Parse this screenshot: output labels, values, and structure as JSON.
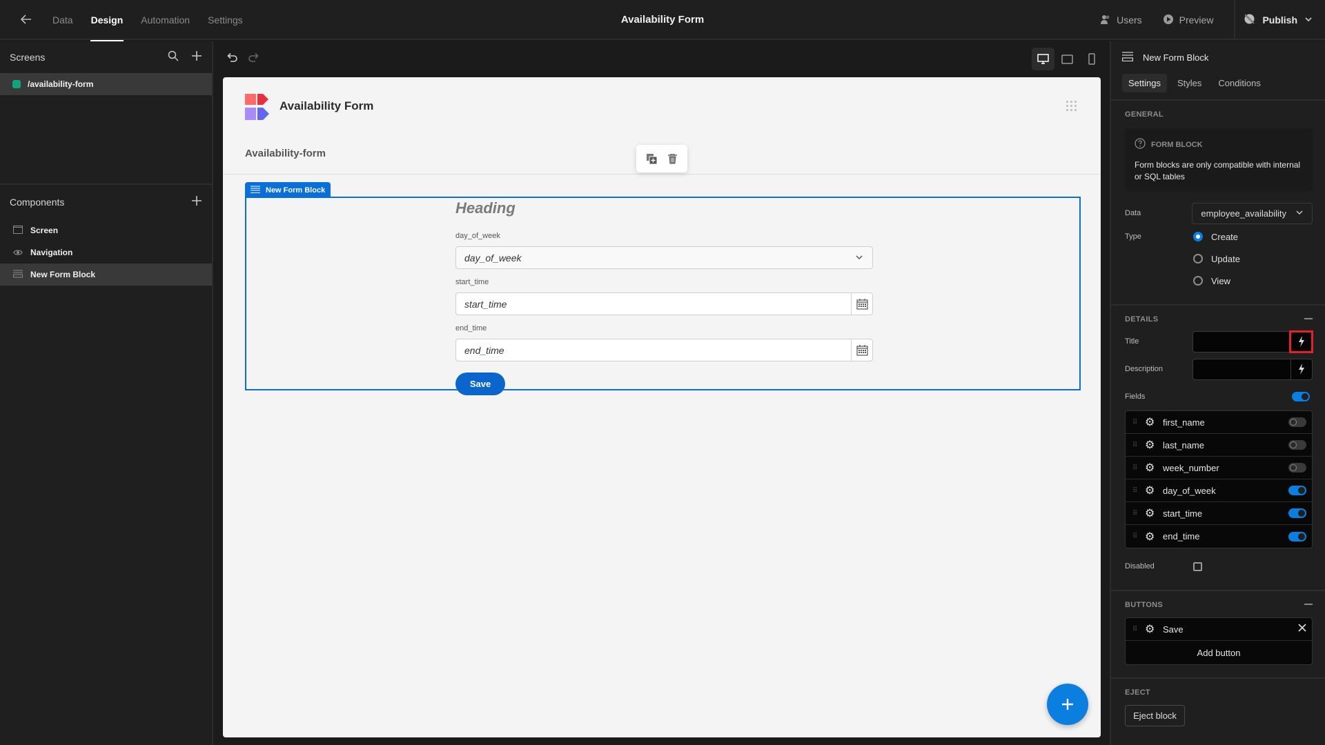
{
  "topbar": {
    "nav_tabs": [
      {
        "label": "Data",
        "active": false
      },
      {
        "label": "Design",
        "active": true
      },
      {
        "label": "Automation",
        "active": false
      },
      {
        "label": "Settings",
        "active": false
      }
    ],
    "app_title": "Availability Form",
    "users_label": "Users",
    "preview_label": "Preview",
    "publish_label": "Publish"
  },
  "sidebar": {
    "screens_title": "Screens",
    "screens": [
      {
        "label": "/availability-form",
        "color": "#12a37d"
      }
    ],
    "components_title": "Components",
    "components": [
      {
        "label": "Screen",
        "icon": "screen-icon",
        "selected": false
      },
      {
        "label": "Navigation",
        "icon": "eye-icon",
        "selected": false
      },
      {
        "label": "New Form Block",
        "icon": "form-block-icon",
        "selected": true
      }
    ]
  },
  "canvas": {
    "site_title": "Availability Form",
    "nav_link": "Availability-form",
    "form_block_tag": "New Form Block",
    "form": {
      "heading": "Heading",
      "fields": [
        {
          "label": "day_of_week",
          "placeholder": "day_of_week",
          "type": "select"
        },
        {
          "label": "start_time",
          "placeholder": "start_time",
          "type": "datetime"
        },
        {
          "label": "end_time",
          "placeholder": "end_time",
          "type": "datetime"
        }
      ],
      "save_label": "Save"
    },
    "accent_color": "#0a6fd8"
  },
  "right_panel": {
    "component_title": "New Form Block",
    "tabs": [
      {
        "label": "Settings",
        "active": true
      },
      {
        "label": "Styles",
        "active": false
      },
      {
        "label": "Conditions",
        "active": false
      }
    ],
    "general": {
      "title": "GENERAL",
      "info_title": "FORM BLOCK",
      "info_text": "Form blocks are only compatible with internal or SQL tables",
      "data_label": "Data",
      "data_value": "employee_availability",
      "type_label": "Type",
      "type_options": [
        {
          "label": "Create",
          "selected": true
        },
        {
          "label": "Update",
          "selected": false
        },
        {
          "label": "View",
          "selected": false
        }
      ]
    },
    "details": {
      "title": "DETAILS",
      "title_label": "Title",
      "title_value": "",
      "description_label": "Description",
      "description_value": "",
      "fields_label": "Fields",
      "fields_enabled": true,
      "fields": [
        {
          "name": "first_name",
          "enabled": false
        },
        {
          "name": "last_name",
          "enabled": false
        },
        {
          "name": "week_number",
          "enabled": false
        },
        {
          "name": "day_of_week",
          "enabled": true
        },
        {
          "name": "start_time",
          "enabled": true
        },
        {
          "name": "end_time",
          "enabled": true
        }
      ],
      "disabled_label": "Disabled",
      "disabled_checked": false
    },
    "buttons": {
      "title": "BUTTONS",
      "items": [
        {
          "label": "Save"
        }
      ],
      "add_label": "Add button"
    },
    "eject": {
      "title": "EJECT",
      "button_label": "Eject block"
    }
  }
}
